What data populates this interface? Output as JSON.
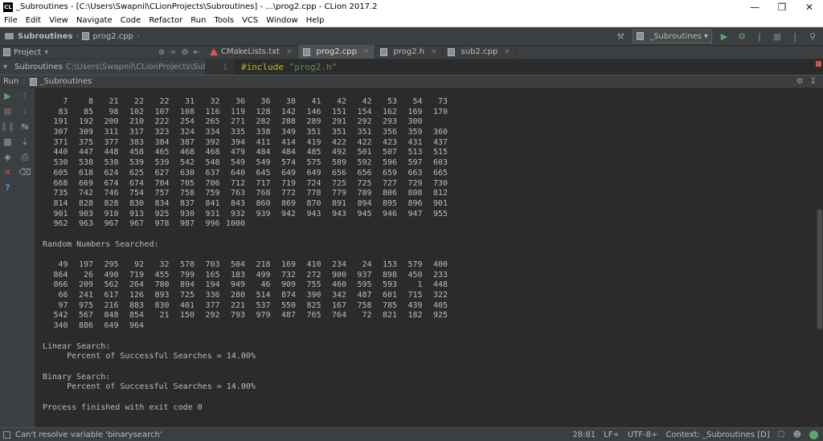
{
  "window": {
    "title": "_Subroutines - [C:\\Users\\Swapnil\\CLionProjects\\Subroutines] - ...\\prog2.cpp - CLion 2017.2",
    "icon_text": "CL"
  },
  "menu": [
    "File",
    "Edit",
    "View",
    "Navigate",
    "Code",
    "Refactor",
    "Run",
    "Tools",
    "VCS",
    "Window",
    "Help"
  ],
  "navbar": {
    "project": "Subroutines",
    "file": "prog2.cpp",
    "run_config": "_Subroutines"
  },
  "project_panel": {
    "header": "Project",
    "root_label": "Subroutines",
    "root_path": "C:\\Users\\Swapnil\\CLionProjects\\Subroutin"
  },
  "tabs": [
    {
      "label": "CMakeLists.txt",
      "active": false
    },
    {
      "label": "prog2.cpp",
      "active": true
    },
    {
      "label": "prog2.h",
      "active": false
    },
    {
      "label": "sub2.cpp",
      "active": false
    }
  ],
  "editor": {
    "line_number": "1",
    "directive": "#include",
    "include": "\"prog2.h\""
  },
  "run_panel": {
    "label": "Run",
    "config": "_Subroutines"
  },
  "console": {
    "sorted_rows": [
      [
        "7",
        "8",
        "21",
        "22",
        "22",
        "31",
        "32",
        "36",
        "36",
        "38",
        "41",
        "42",
        "42",
        "53",
        "54",
        "73"
      ],
      [
        "83",
        "85",
        "98",
        "102",
        "107",
        "108",
        "116",
        "119",
        "128",
        "142",
        "146",
        "151",
        "154",
        "162",
        "169",
        "170"
      ],
      [
        "191",
        "192",
        "200",
        "210",
        "222",
        "254",
        "265",
        "271",
        "282",
        "288",
        "289",
        "291",
        "292",
        "293",
        "300"
      ],
      [
        "307",
        "309",
        "311",
        "317",
        "323",
        "324",
        "334",
        "335",
        "338",
        "349",
        "351",
        "351",
        "351",
        "356",
        "359",
        "360"
      ],
      [
        "371",
        "375",
        "377",
        "383",
        "384",
        "387",
        "392",
        "394",
        "411",
        "414",
        "419",
        "422",
        "422",
        "423",
        "431",
        "437"
      ],
      [
        "440",
        "447",
        "448",
        "458",
        "465",
        "468",
        "468",
        "479",
        "484",
        "484",
        "485",
        "492",
        "501",
        "507",
        "513",
        "515"
      ],
      [
        "530",
        "538",
        "538",
        "539",
        "539",
        "542",
        "548",
        "549",
        "549",
        "574",
        "575",
        "589",
        "592",
        "596",
        "597",
        "603"
      ],
      [
        "605",
        "618",
        "624",
        "625",
        "627",
        "630",
        "637",
        "640",
        "645",
        "649",
        "649",
        "656",
        "656",
        "659",
        "663",
        "665"
      ],
      [
        "668",
        "669",
        "674",
        "674",
        "704",
        "705",
        "706",
        "712",
        "717",
        "719",
        "724",
        "725",
        "725",
        "727",
        "729",
        "730"
      ],
      [
        "735",
        "742",
        "746",
        "754",
        "757",
        "758",
        "759",
        "763",
        "768",
        "772",
        "778",
        "779",
        "789",
        "806",
        "808",
        "812"
      ],
      [
        "814",
        "828",
        "828",
        "830",
        "834",
        "837",
        "841",
        "843",
        "860",
        "869",
        "870",
        "891",
        "894",
        "895",
        "896",
        "901"
      ],
      [
        "901",
        "903",
        "910",
        "913",
        "925",
        "930",
        "931",
        "932",
        "939",
        "942",
        "943",
        "943",
        "945",
        "946",
        "947",
        "955"
      ],
      [
        "962",
        "963",
        "967",
        "967",
        "978",
        "987",
        "996",
        "1000"
      ]
    ],
    "random_heading": "Random Numbers Searched:",
    "random_rows": [
      [
        "49",
        "197",
        "295",
        "92",
        "32",
        "578",
        "703",
        "504",
        "218",
        "169",
        "410",
        "234",
        "24",
        "153",
        "579",
        "400"
      ],
      [
        "864",
        "26",
        "490",
        "719",
        "455",
        "799",
        "165",
        "183",
        "499",
        "732",
        "272",
        "900",
        "937",
        "898",
        "450",
        "233"
      ],
      [
        "866",
        "209",
        "562",
        "264",
        "780",
        "894",
        "194",
        "949",
        "46",
        "909",
        "755",
        "460",
        "595",
        "593",
        "1",
        "448"
      ],
      [
        "66",
        "241",
        "617",
        "126",
        "893",
        "725",
        "336",
        "280",
        "514",
        "874",
        "390",
        "342",
        "487",
        "601",
        "715",
        "322"
      ],
      [
        "97",
        "975",
        "216",
        "883",
        "830",
        "401",
        "377",
        "221",
        "537",
        "550",
        "825",
        "167",
        "758",
        "785",
        "439",
        "405"
      ],
      [
        "542",
        "567",
        "848",
        "854",
        "21",
        "150",
        "292",
        "793",
        "979",
        "487",
        "765",
        "764",
        "72",
        "821",
        "182",
        "925"
      ],
      [
        "340",
        "886",
        "649",
        "964"
      ]
    ],
    "linear_heading": "Linear Search:",
    "linear_result": "     Percent of Successful Searches = 14.00%",
    "binary_heading": "Binary Search:",
    "binary_result": "     Percent of Successful Searches = 14.00%",
    "exit_message": "Process finished with exit code 0"
  },
  "statusbar": {
    "message": "Can't resolve variable 'binarysearch'",
    "position": "28:81",
    "line_sep": "LF÷",
    "encoding": "UTF-8÷",
    "context": "Context: _Subroutines [D]"
  }
}
